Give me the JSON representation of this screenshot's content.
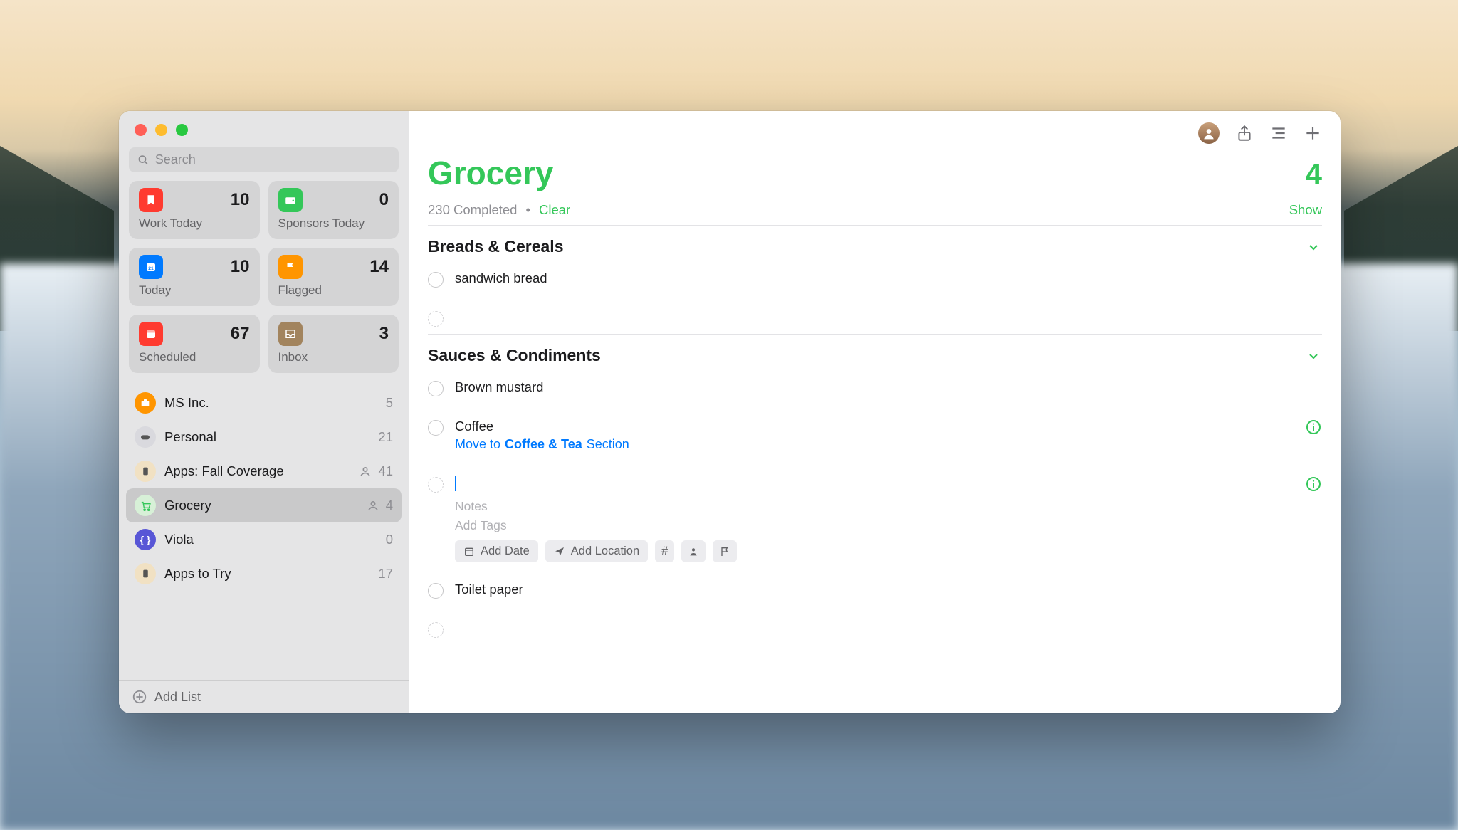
{
  "accent_color": "#34c759",
  "sidebar": {
    "search_placeholder": "Search",
    "smart": [
      {
        "id": "work-today",
        "label": "Work Today",
        "count": "10",
        "icon_bg": "#ff3b30"
      },
      {
        "id": "sponsors-today",
        "label": "Sponsors Today",
        "count": "0",
        "icon_bg": "#34c759"
      },
      {
        "id": "today",
        "label": "Today",
        "count": "10",
        "icon_bg": "#007aff"
      },
      {
        "id": "flagged",
        "label": "Flagged",
        "count": "14",
        "icon_bg": "#ff9500"
      },
      {
        "id": "scheduled",
        "label": "Scheduled",
        "count": "67",
        "icon_bg": "#ff3b30"
      },
      {
        "id": "inbox",
        "label": "Inbox",
        "count": "3",
        "icon_bg": "#a2845e"
      }
    ],
    "lists": [
      {
        "id": "ms-inc",
        "name": "MS Inc.",
        "count": "5",
        "shared": false,
        "icon_bg": "#ff9500",
        "selected": false
      },
      {
        "id": "personal",
        "name": "Personal",
        "count": "21",
        "shared": false,
        "icon_bg": "#d9d9de",
        "selected": false
      },
      {
        "id": "apps-fall",
        "name": "Apps: Fall Coverage",
        "count": "41",
        "shared": true,
        "icon_bg": "#f1e1c3",
        "selected": false
      },
      {
        "id": "grocery",
        "name": "Grocery",
        "count": "4",
        "shared": true,
        "icon_bg": "#d7f0d7",
        "selected": true
      },
      {
        "id": "viola",
        "name": "Viola",
        "count": "0",
        "shared": false,
        "icon_bg": "#5856d6",
        "selected": false
      },
      {
        "id": "apps-try",
        "name": "Apps to Try",
        "count": "17",
        "shared": false,
        "icon_bg": "#f1e1c3",
        "selected": false
      }
    ],
    "add_list_label": "Add List"
  },
  "main": {
    "title": "Grocery",
    "count": "4",
    "completed_text": "230 Completed",
    "clear_label": "Clear",
    "show_label": "Show",
    "editor": {
      "notes_placeholder": "Notes",
      "tags_placeholder": "Add Tags",
      "add_date_label": "Add Date",
      "add_location_label": "Add Location"
    },
    "sections": [
      {
        "id": "breads-cereals",
        "title": "Breads & Cereals",
        "items": [
          {
            "text": "sandwich bread"
          }
        ]
      },
      {
        "id": "sauces-condiments",
        "title": "Sauces & Condiments",
        "items": [
          {
            "text": "Brown mustard"
          },
          {
            "text": "Coffee",
            "suggestion_prefix": "Move to",
            "suggestion_target": "Coffee & Tea",
            "suggestion_suffix": "Section",
            "info": true
          },
          {
            "text": "Toilet paper"
          }
        ]
      }
    ]
  }
}
